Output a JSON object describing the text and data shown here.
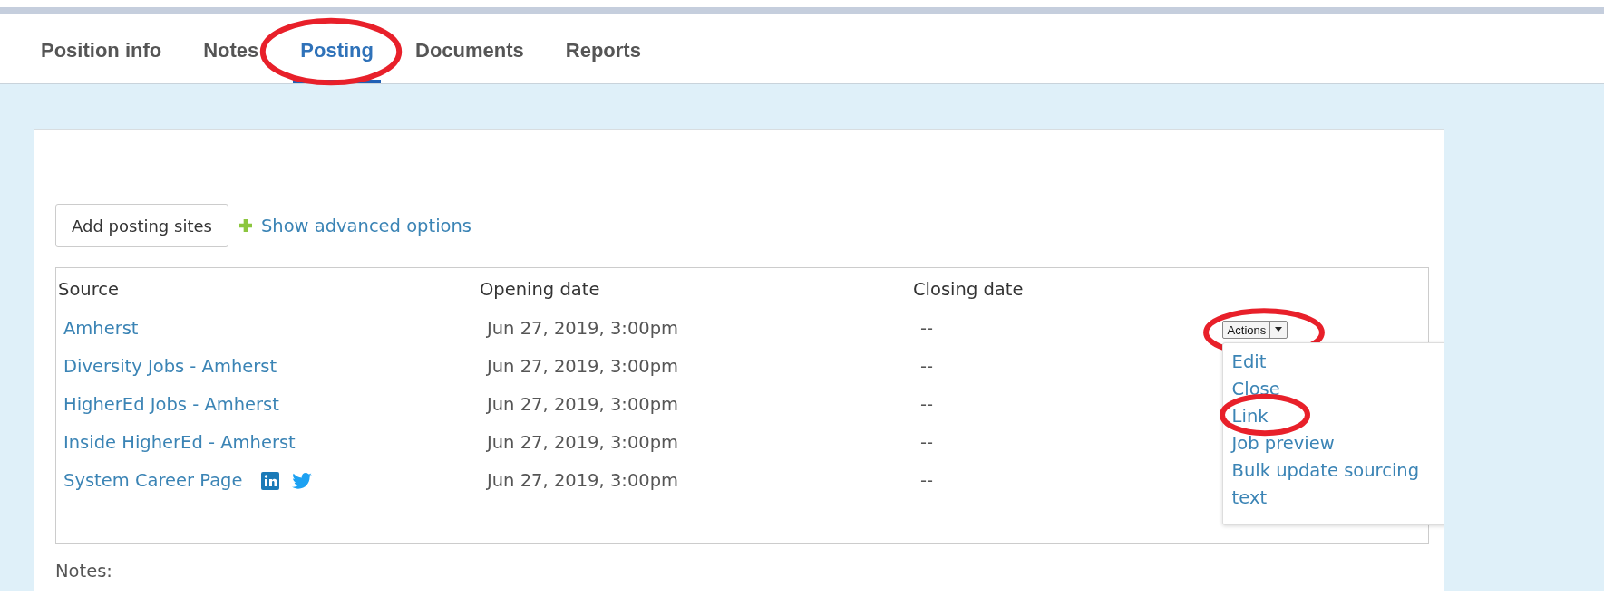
{
  "tabs": [
    {
      "label": "Position info",
      "selected": false,
      "circled": false
    },
    {
      "label": "Notes",
      "selected": false,
      "circled": false
    },
    {
      "label": "Posting",
      "selected": true,
      "circled": true
    },
    {
      "label": "Documents",
      "selected": false,
      "circled": false
    },
    {
      "label": "Reports",
      "selected": false,
      "circled": false
    }
  ],
  "add_button": "Add posting sites",
  "advanced_link": "Show advanced options",
  "table": {
    "columns": [
      "Source",
      "Opening date",
      "Closing date"
    ],
    "rows": [
      {
        "source": "Amherst",
        "opening": "Jun 27, 2019, 3:00pm",
        "closing": "--",
        "social": false,
        "actions": {
          "label": "Actions",
          "circled": true,
          "expanded": true
        }
      },
      {
        "source": "Diversity Jobs - Amherst",
        "opening": "Jun 27, 2019, 3:00pm",
        "closing": "--",
        "social": false
      },
      {
        "source": "HigherEd Jobs - Amherst",
        "opening": "Jun 27, 2019, 3:00pm",
        "closing": "--",
        "social": false
      },
      {
        "source": "Inside HigherEd - Amherst",
        "opening": "Jun 27, 2019, 3:00pm",
        "closing": "--",
        "social": false
      },
      {
        "source": "System Career Page",
        "opening": "Jun 27, 2019, 3:00pm",
        "closing": "--",
        "social": true
      }
    ]
  },
  "actions_menu": [
    {
      "label": "Edit",
      "circled": false
    },
    {
      "label": "Close",
      "circled": false
    },
    {
      "label": "Link",
      "circled": true
    },
    {
      "label": "Job preview",
      "circled": false
    },
    {
      "label": "Bulk update sourcing text",
      "circled": false
    }
  ],
  "notes_label": "Notes:"
}
